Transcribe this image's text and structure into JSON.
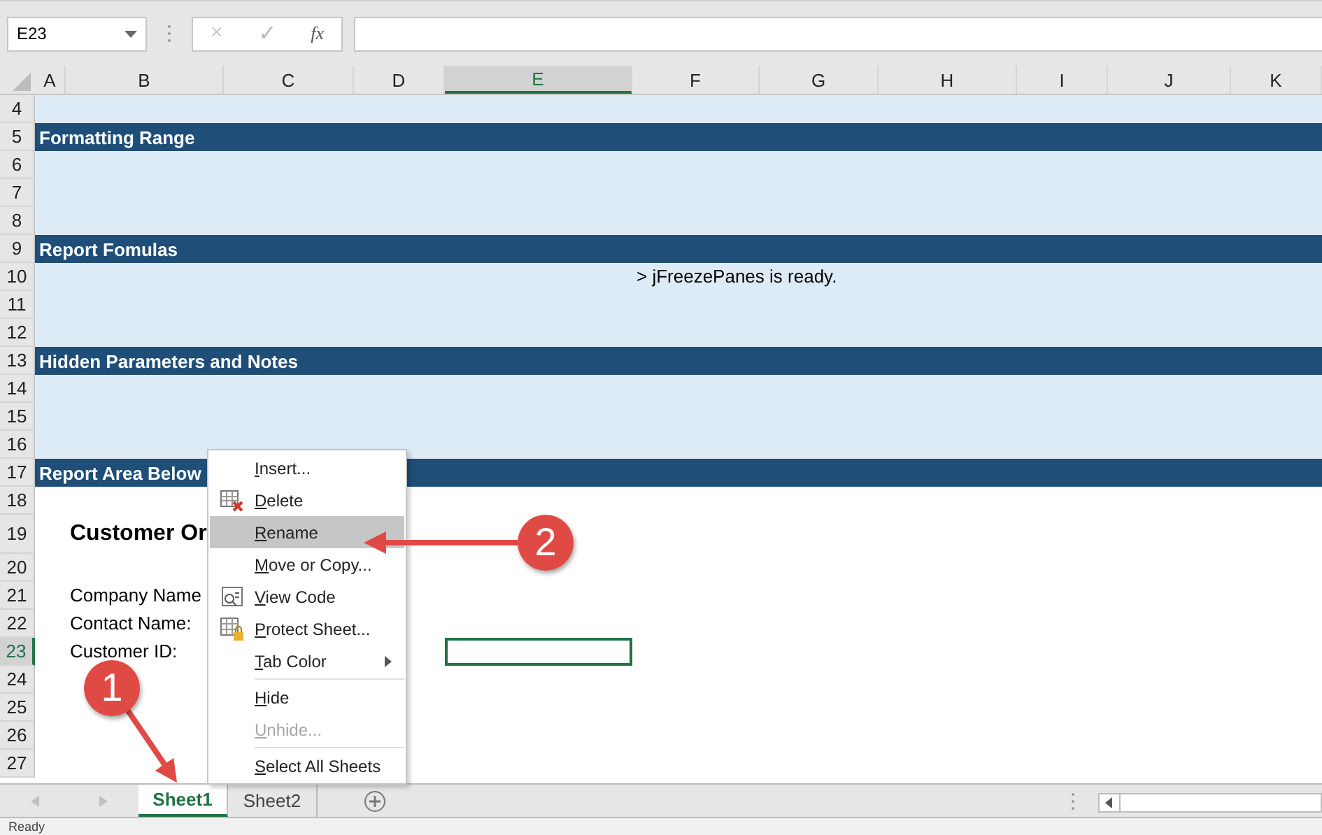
{
  "formula_bar": {
    "name_box": "E23",
    "cancel": "×",
    "enter": "✓",
    "function": "fx"
  },
  "columns": [
    {
      "label": "A",
      "selected": false
    },
    {
      "label": "B",
      "selected": false
    },
    {
      "label": "C",
      "selected": false
    },
    {
      "label": "D",
      "selected": false
    },
    {
      "label": "E",
      "selected": true
    },
    {
      "label": "F",
      "selected": false
    },
    {
      "label": "G",
      "selected": false
    },
    {
      "label": "H",
      "selected": false
    },
    {
      "label": "I",
      "selected": false
    },
    {
      "label": "J",
      "selected": false
    },
    {
      "label": "K",
      "selected": false
    }
  ],
  "rows": [
    {
      "number": "4",
      "kind": "fill",
      "selected": false
    },
    {
      "number": "5",
      "kind": "band",
      "selected": false,
      "text": "Formatting Range"
    },
    {
      "number": "6",
      "kind": "fill",
      "selected": false
    },
    {
      "number": "7",
      "kind": "fill",
      "selected": false
    },
    {
      "number": "8",
      "kind": "fill",
      "selected": false
    },
    {
      "number": "9",
      "kind": "band",
      "selected": false,
      "text": "Report Fomulas"
    },
    {
      "number": "10",
      "kind": "fill",
      "selected": false,
      "cells": [
        {
          "kind": "note",
          "text": "> jFreezePanes is ready."
        }
      ]
    },
    {
      "number": "11",
      "kind": "fill",
      "selected": false
    },
    {
      "number": "12",
      "kind": "fill",
      "selected": false
    },
    {
      "number": "13",
      "kind": "band",
      "selected": false,
      "text": "Hidden Parameters and Notes"
    },
    {
      "number": "14",
      "kind": "fill",
      "selected": false
    },
    {
      "number": "15",
      "kind": "fill",
      "selected": false
    },
    {
      "number": "16",
      "kind": "fill",
      "selected": false
    },
    {
      "number": "17",
      "kind": "band",
      "selected": false,
      "text": "Report Area Below"
    },
    {
      "number": "18",
      "kind": "plain",
      "selected": false
    },
    {
      "number": "19",
      "kind": "plain",
      "selected": false,
      "cells": [
        {
          "kind": "title",
          "text": "Customer Or"
        }
      ]
    },
    {
      "number": "20",
      "kind": "plain",
      "selected": false
    },
    {
      "number": "21",
      "kind": "plain",
      "selected": false,
      "cells": [
        {
          "kind": "label",
          "text": "Company Name"
        }
      ]
    },
    {
      "number": "22",
      "kind": "plain",
      "selected": false,
      "cells": [
        {
          "kind": "label",
          "text": "Contact Name:"
        }
      ]
    },
    {
      "number": "23",
      "kind": "plain",
      "selected": true,
      "cells": [
        {
          "kind": "label",
          "text": "Customer ID:"
        },
        {
          "kind": "active"
        }
      ]
    },
    {
      "number": "24",
      "kind": "plain",
      "selected": false
    },
    {
      "number": "25",
      "kind": "plain",
      "selected": false
    },
    {
      "number": "26",
      "kind": "plain",
      "selected": false
    },
    {
      "number": "27",
      "kind": "plain",
      "selected": false
    }
  ],
  "context_menu": [
    {
      "kind": "item",
      "label": "Insert...",
      "selected": false,
      "disabled": false
    },
    {
      "kind": "delete",
      "label": "Delete",
      "selected": false,
      "disabled": false
    },
    {
      "kind": "item",
      "label": "Rename",
      "selected": true,
      "disabled": false
    },
    {
      "kind": "item",
      "label": "Move or Copy...",
      "selected": false,
      "disabled": false
    },
    {
      "kind": "code",
      "label": "View Code",
      "selected": false,
      "disabled": false
    },
    {
      "kind": "protect",
      "label": "Protect Sheet...",
      "selected": false,
      "disabled": false
    },
    {
      "kind": "submenu",
      "label": "Tab Color",
      "selected": false,
      "disabled": false
    },
    {
      "kind": "separator"
    },
    {
      "kind": "item",
      "label": "Hide",
      "selected": false,
      "disabled": false
    },
    {
      "kind": "item",
      "label": "Unhide...",
      "selected": false,
      "disabled": true
    },
    {
      "kind": "separator"
    },
    {
      "kind": "item",
      "label": "Select All Sheets",
      "selected": false,
      "disabled": false
    }
  ],
  "sheet_tabs": [
    {
      "label": "Sheet1",
      "selected": true
    },
    {
      "label": "Sheet2",
      "selected": false
    }
  ],
  "callouts": [
    "1",
    "2"
  ],
  "status_bar": "Ready"
}
